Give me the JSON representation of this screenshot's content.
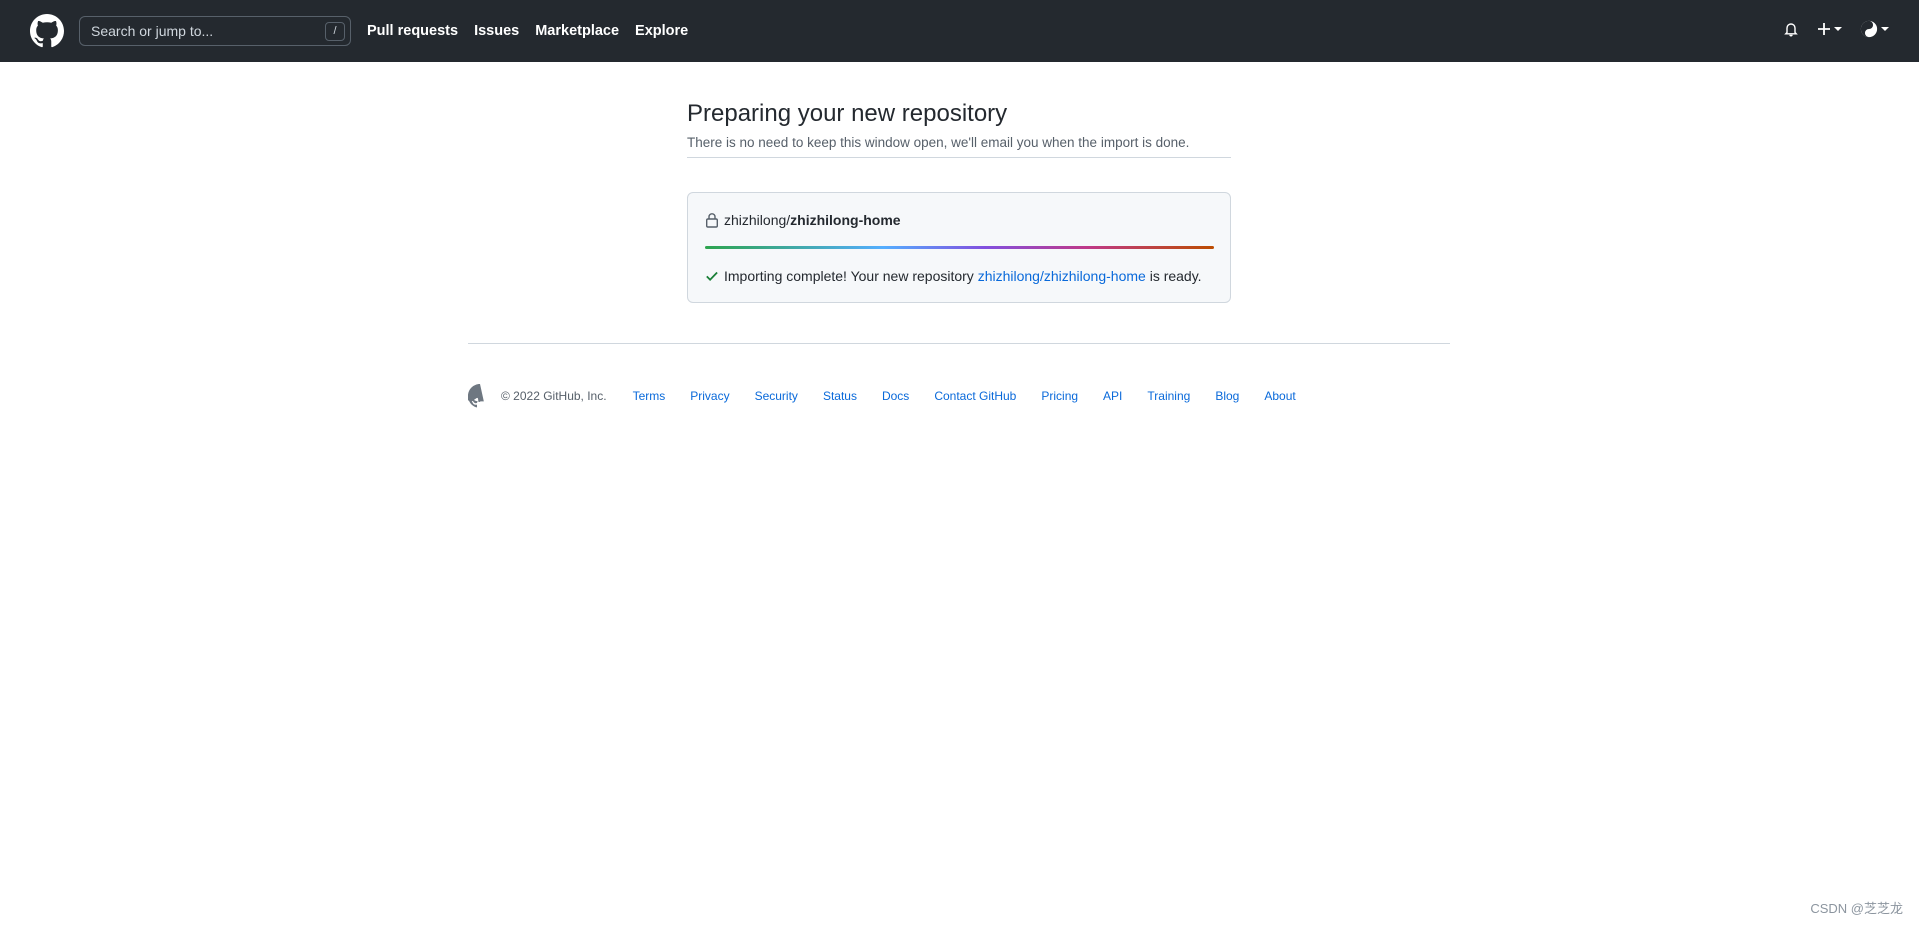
{
  "header": {
    "search_placeholder": "Search or jump to...",
    "search_shortcut": "/",
    "nav": [
      {
        "label": "Pull requests"
      },
      {
        "label": "Issues"
      },
      {
        "label": "Marketplace"
      },
      {
        "label": "Explore"
      }
    ],
    "icons": {
      "logo": "github-mark-icon",
      "notifications": "bell-icon",
      "create": "plus-icon",
      "avatar": "yin-yang-avatar-icon"
    }
  },
  "main": {
    "title": "Preparing your new repository",
    "subtitle": "There is no need to keep this window open, we'll email you when the import is done.",
    "repo": {
      "owner": "zhizhilong/",
      "name": "zhizhilong-home"
    },
    "progress_percent": 100,
    "status": {
      "prefix": "Importing complete! Your new repository ",
      "link": "zhizhilong/zhizhilong-home",
      "suffix": " is ready."
    }
  },
  "footer": {
    "copyright": "© 2022 GitHub, Inc.",
    "links": [
      {
        "label": "Terms"
      },
      {
        "label": "Privacy"
      },
      {
        "label": "Security"
      },
      {
        "label": "Status"
      },
      {
        "label": "Docs"
      },
      {
        "label": "Contact GitHub"
      },
      {
        "label": "Pricing"
      },
      {
        "label": "API"
      },
      {
        "label": "Training"
      },
      {
        "label": "Blog"
      },
      {
        "label": "About"
      }
    ]
  },
  "watermark": "CSDN @芝芝龙",
  "colors": {
    "header_bg": "#24292f",
    "link": "#0969da",
    "success": "#1a7f37"
  }
}
